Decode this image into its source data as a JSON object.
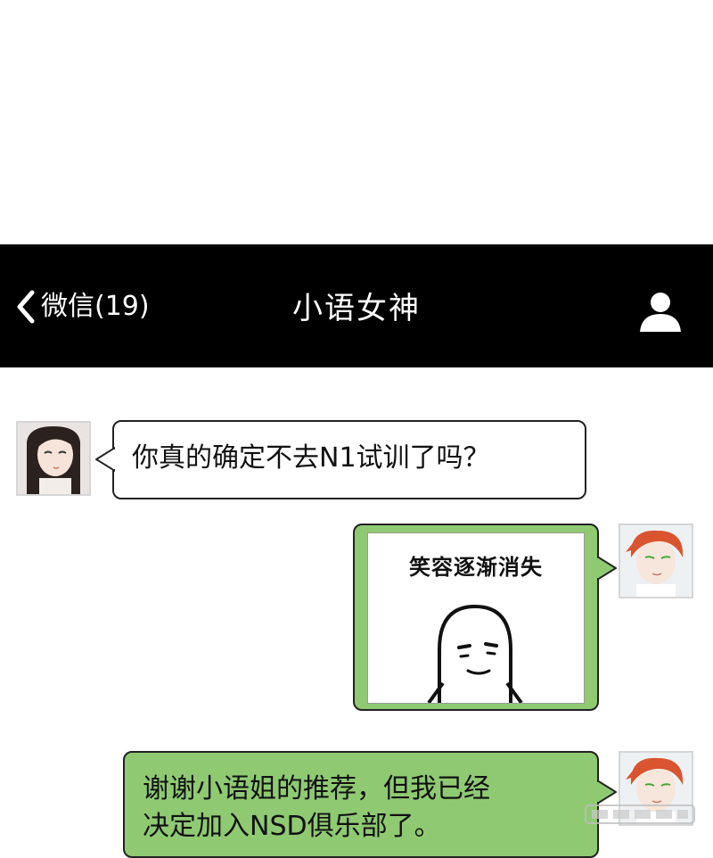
{
  "nav": {
    "back_label": "微信(19)",
    "title": "小语女神",
    "back_icon": "chevron-left-icon",
    "profile_icon": "person-icon"
  },
  "colors": {
    "nav_bg": "#000000",
    "left_bubble": "#ffffff",
    "right_bubble": "#8fca72"
  },
  "messages": [
    {
      "sender": "contact",
      "avatar": "contact-avatar",
      "type": "text",
      "text": "你真的确定不去N1试训了吗？"
    },
    {
      "sender": "me",
      "avatar": "user-avatar",
      "type": "sticker",
      "caption": "笑容逐渐消失"
    },
    {
      "sender": "me",
      "avatar": "user-avatar",
      "type": "text",
      "text": "谢谢小语姐的推荐，但我已经\n决定加入NSD俱乐部了。"
    }
  ]
}
